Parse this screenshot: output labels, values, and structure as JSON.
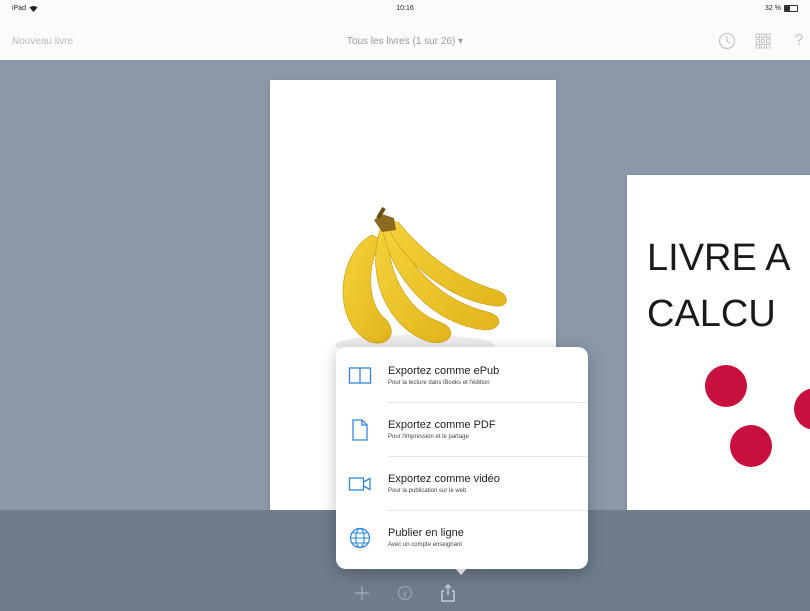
{
  "status_bar": {
    "device": "iPad",
    "time": "10:16",
    "battery": "32 %"
  },
  "nav": {
    "left": "Nouveau livre",
    "title": "Tous les livres (1 sur 26) ▾",
    "icons": [
      "clock-icon",
      "grid-icon",
      "help-icon"
    ],
    "help_glyph": "?"
  },
  "right_page": {
    "title_line1": "LIVRE A",
    "title_line2": "CALCU"
  },
  "export_menu": {
    "items": [
      {
        "icon": "book-icon",
        "title": "Exportez comme ePub",
        "subtitle": "Pour la lecture dans iBooks et l'édition"
      },
      {
        "icon": "document-icon",
        "title": "Exportez comme PDF",
        "subtitle": "Pour l'impression et le partage"
      },
      {
        "icon": "video-icon",
        "title": "Exportez comme vidéo",
        "subtitle": "Pour la publication sur le web"
      },
      {
        "icon": "globe-icon",
        "title": "Publier en ligne",
        "subtitle": "Avec un compte enseignant"
      }
    ]
  },
  "toolbar": {
    "icons": [
      "plus-icon",
      "info-icon",
      "share-icon"
    ]
  },
  "colors": {
    "canvas": "#8a98a8",
    "accent": "#2e86de",
    "dot": "#c8103f"
  }
}
